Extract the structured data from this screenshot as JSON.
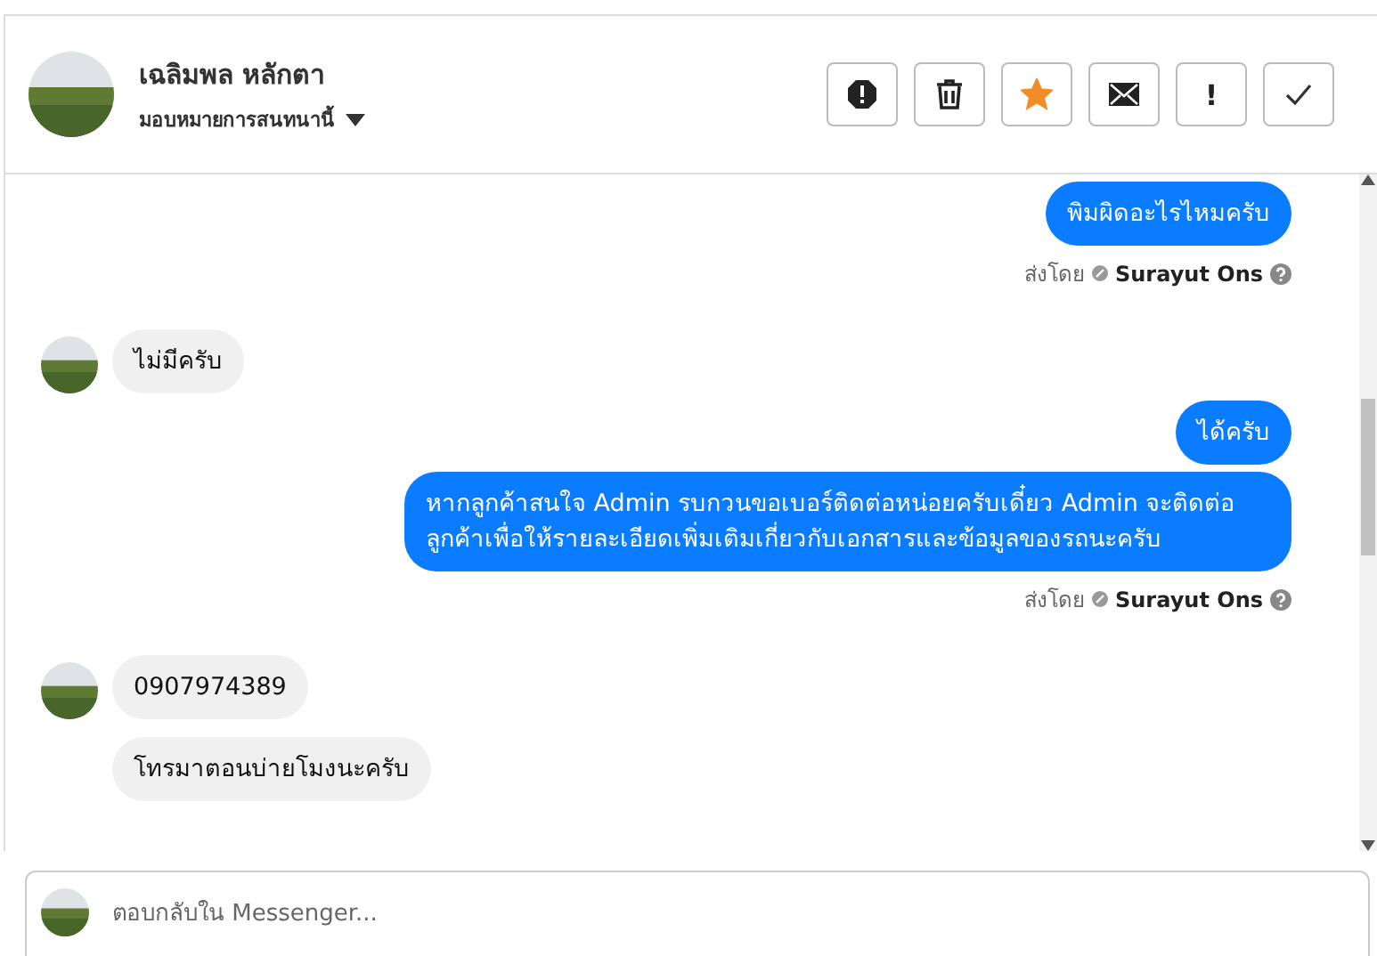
{
  "header": {
    "name": "เฉลิมพล หลักตา",
    "assign_label": "มอบหมายการสนทนานี้",
    "actions": [
      {
        "kind": "alert"
      },
      {
        "kind": "trash"
      },
      {
        "kind": "star",
        "on": true
      },
      {
        "kind": "mail"
      },
      {
        "kind": "exclaim",
        "label": "!"
      },
      {
        "kind": "check"
      }
    ]
  },
  "messages": [
    {
      "kind": "outgoing",
      "text": "พิมผิดอะไรไหมครับ"
    },
    {
      "kind": "sent_by",
      "prefix": "ส่งโดย",
      "sender": "Surayut Ons"
    },
    {
      "kind": "incoming",
      "text": "ไม่มีครับ",
      "avatar": true
    },
    {
      "kind": "outgoing",
      "text": "ได้ครับ"
    },
    {
      "kind": "outgoing",
      "text": "หากลูกค้าสนใจ Admin รบกวนขอเบอร์ติดต่อหน่อยครับเดี๋ยว Admin จะติดต่อลูกค้าเพื่อให้รายละเอียดเพิ่มเติมเกี่ยวกับเอกสารและข้อมูลของรถนะครับ"
    },
    {
      "kind": "sent_by",
      "prefix": "ส่งโดย",
      "sender": "Surayut Ons"
    },
    {
      "kind": "incoming",
      "text": "0907974389",
      "avatar": true
    },
    {
      "kind": "incoming",
      "text": "โทรมาตอนบ่ายโมงนะครับ",
      "avatar": false
    }
  ],
  "composer": {
    "placeholder": "ตอบกลับใน Messenger..."
  }
}
